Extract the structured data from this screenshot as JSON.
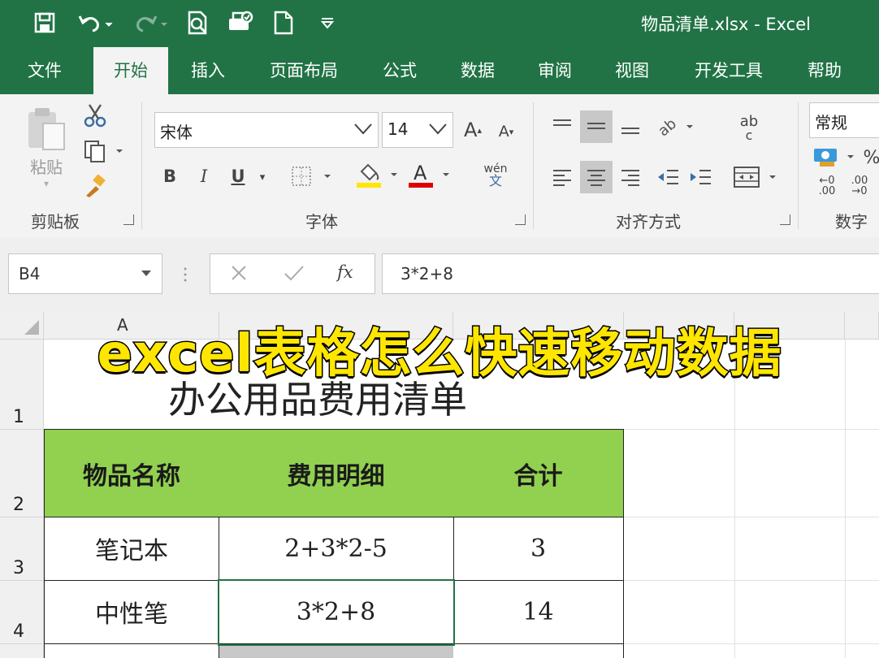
{
  "window": {
    "title": "物品清单.xlsx  -  Excel"
  },
  "tabs": [
    "文件",
    "开始",
    "插入",
    "页面布局",
    "公式",
    "数据",
    "审阅",
    "视图",
    "开发工具",
    "帮助"
  ],
  "active_tab": "开始",
  "ribbon": {
    "clipboard": {
      "label": "剪贴板",
      "paste": "粘贴"
    },
    "font": {
      "label": "字体",
      "font_name": "宋体",
      "font_size": "14",
      "grow": "A",
      "shrink": "A",
      "bold": "B",
      "italic": "I",
      "underline": "U",
      "phonetic_top": "wén",
      "phonetic_bottom": "文"
    },
    "alignment": {
      "label": "对齐方式",
      "wrap_top": "ab",
      "wrap_bottom": "c"
    },
    "number": {
      "label": "数字",
      "format": "常规",
      "percent": "%",
      "inc_decimal_top": "←0",
      "inc_decimal_bottom": ".00",
      "dec_decimal_top": ".00",
      "dec_decimal_bottom": "→0"
    }
  },
  "formula_bar": {
    "name_box": "B4",
    "fx": "fx",
    "formula": "3*2+8"
  },
  "sheet": {
    "col_header_a": "A",
    "rows": [
      "1",
      "2",
      "3",
      "4"
    ],
    "title": "办公用品费用清单",
    "headers": [
      "物品名称",
      "费用明细",
      "合计"
    ],
    "data": [
      [
        "笔记本",
        "2+3*2-5",
        "3"
      ],
      [
        "中性笔",
        "3*2+8",
        "14"
      ]
    ]
  },
  "overlay": {
    "caption": "excel表格怎么快速移动数据"
  },
  "colors": {
    "excel_green": "#217346",
    "header_fill": "#92d050",
    "caption": "#ffe600"
  }
}
